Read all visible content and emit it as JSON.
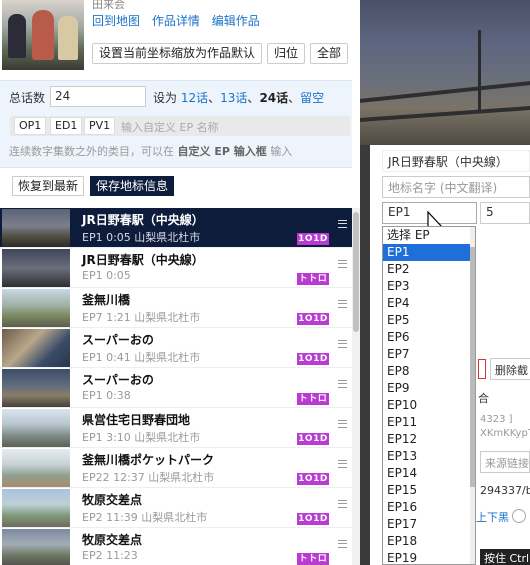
{
  "header": {
    "title_partial": "田来会",
    "links": [
      "回到地图",
      "作品详情",
      "编辑作品"
    ],
    "buttons": [
      "设置当前坐标缩放为作品默认",
      "归位",
      "全部"
    ]
  },
  "count_panel": {
    "label": "总话数",
    "value": "24",
    "set_as_prefix": "设为",
    "options": [
      "12话",
      "13话",
      "24话",
      "留空"
    ],
    "sep": "、",
    "ep_chips": [
      "OP1",
      "ED1",
      "PV1"
    ],
    "ep_placeholder": "输入自定义 EP 名称",
    "note_prefix": "连续数字集数之外的类目，可以在",
    "note_bold": "自定义 EP 输入框",
    "note_suffix": "输入"
  },
  "actions": {
    "restore": "恢复到最新",
    "save": "保存地标信息"
  },
  "points": [
    {
      "name": "JR日野春駅（中央線）",
      "sub": "EP1  0:05  山梨県北杜市",
      "tag": "1O1D",
      "active": true
    },
    {
      "name": "JR日野春駅（中央線）",
      "sub": "EP1  0:05",
      "tag": "トトロ",
      "active": false
    },
    {
      "name": "釜無川橋",
      "sub": "EP7  1:21  山梨県北杜市",
      "tag": "1O1D",
      "active": false
    },
    {
      "name": "スーパーおの",
      "sub": "EP1  0:41  山梨県北杜市",
      "tag": "1O1D",
      "active": false
    },
    {
      "name": "スーパーおの",
      "sub": "EP1  0:38",
      "tag": "トトロ",
      "active": false
    },
    {
      "name": "県営住宅日野春団地",
      "sub": "EP1  3:10  山梨県北杜市",
      "tag": "1O1D",
      "active": false
    },
    {
      "name": "釜無川橋ポケットパーク",
      "sub": "EP22  12:37  山梨県北杜市",
      "tag": "1O1D",
      "active": false
    },
    {
      "name": "牧原交差点",
      "sub": "EP2  11:39  山梨県北杜市",
      "tag": "1O1D",
      "active": false
    },
    {
      "name": "牧原交差点",
      "sub": "EP2  11:23",
      "tag": "トトロ",
      "active": false
    }
  ],
  "editor": {
    "name_value": "JR日野春駅（中央線）",
    "translation_placeholder": "地标名字 (中文翻译)",
    "episode_value": "EP1",
    "time_value": "5",
    "frag_delete": "删除截",
    "frag_he": "合",
    "frag_id1": "4323 ]",
    "frag_id2": "XKmKKypTt",
    "frag_source": "来源链接",
    "frag_url": "294337/b",
    "frag_updown": "上下黑",
    "frag_bottom": "按住 Ctrl"
  },
  "episode_dropdown": {
    "options": [
      "选择 EP",
      "EP1",
      "EP2",
      "EP3",
      "EP4",
      "EP5",
      "EP6",
      "EP7",
      "EP8",
      "EP9",
      "EP10",
      "EP11",
      "EP12",
      "EP13",
      "EP14",
      "EP15",
      "EP16",
      "EP17",
      "EP18",
      "EP19"
    ],
    "highlighted": "EP1"
  },
  "colors": {
    "accent": "#1a73c9",
    "active_row": "#0e1c3c",
    "tag": "#b93bd1",
    "dropdown_highlight": "#1e6fd9",
    "panel_bg": "#eef4fc"
  }
}
